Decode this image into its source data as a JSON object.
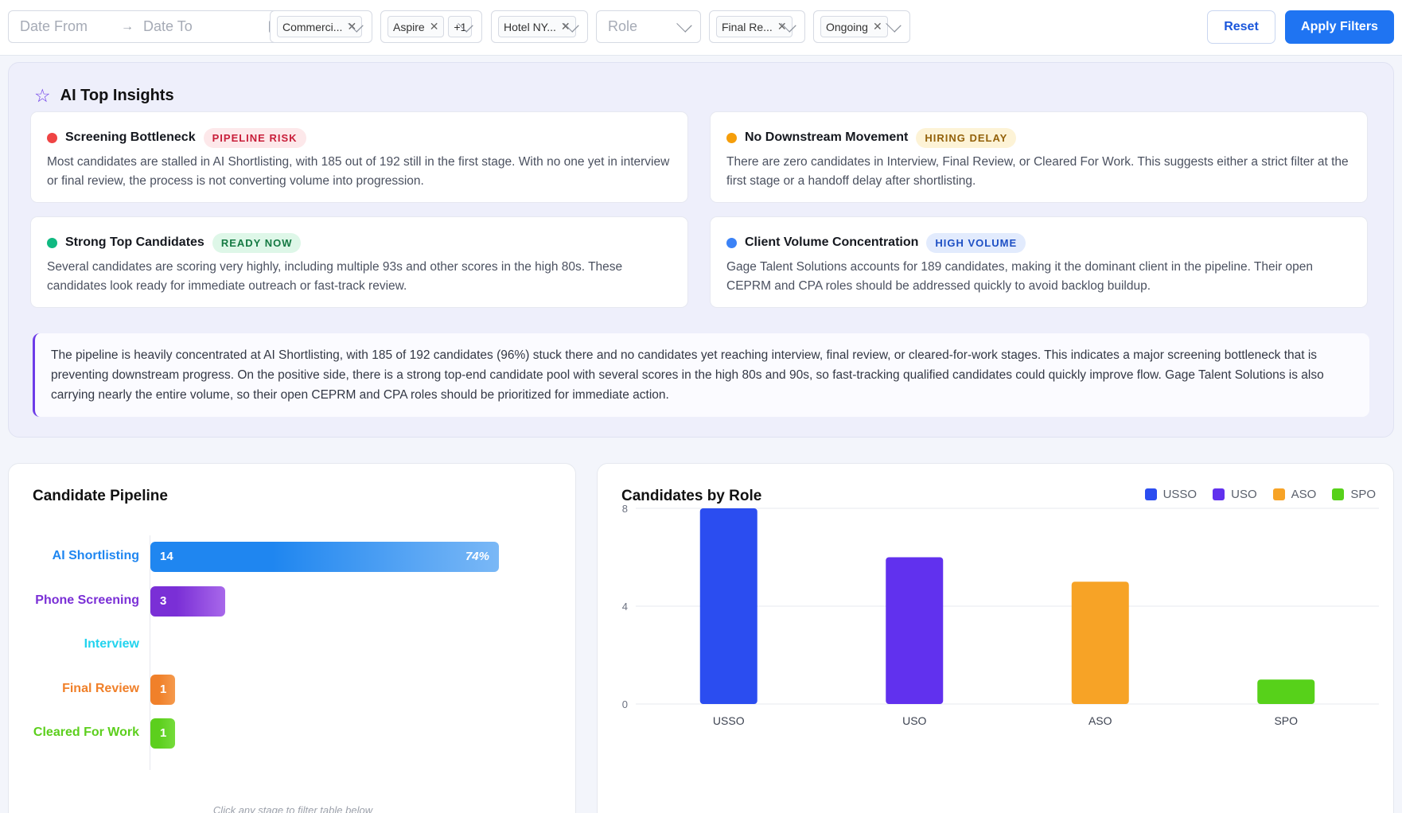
{
  "filters": {
    "date_from_placeholder": "Date From",
    "date_to_placeholder": "Date To",
    "client_tag": "Commerci...",
    "program_tag": "Aspire",
    "program_more": "+1",
    "location_tag": "Hotel NY...",
    "role_placeholder": "Role",
    "stage_tag": "Final Re...",
    "status_tag": "Ongoing",
    "reset_label": "Reset",
    "apply_label": "Apply Filters"
  },
  "insights": {
    "title": "AI Top Insights",
    "cards": [
      {
        "title": "Screening Bottleneck",
        "badge": "PIPELINE RISK",
        "dot_color": "#ef4444",
        "badge_bg": "#fde8ea",
        "badge_fg": "#c81e3a",
        "text": "Most candidates are stalled in AI Shortlisting, with 185 out of 192 still in the first stage. With no one yet in interview or final review, the process is not converting volume into progression."
      },
      {
        "title": "No Downstream Movement",
        "badge": "HIRING DELAY",
        "dot_color": "#f59e0b",
        "badge_bg": "#fdf3d6",
        "badge_fg": "#93610a",
        "text": "There are zero candidates in Interview, Final Review, or Cleared For Work. This suggests either a strict filter at the first stage or a handoff delay after shortlisting."
      },
      {
        "title": "Strong Top Candidates",
        "badge": "READY NOW",
        "dot_color": "#10b981",
        "badge_bg": "#def7e8",
        "badge_fg": "#157a43",
        "text": "Several candidates are scoring very highly, including multiple 93s and other scores in the high 80s. These candidates look ready for immediate outreach or fast-track review."
      },
      {
        "title": "Client Volume Concentration",
        "badge": "HIGH VOLUME",
        "dot_color": "#3b82f6",
        "badge_bg": "#e2ebfd",
        "badge_fg": "#1d4fc4",
        "text": "Gage Talent Solutions accounts for 189 candidates, making it the dominant client in the pipeline. Their open CEPRM and CPA roles should be addressed quickly to avoid backlog buildup."
      }
    ],
    "summary": "The pipeline is heavily concentrated at AI Shortlisting, with 185 of 192 candidates (96%) stuck there and no candidates yet reaching interview, final review, or cleared-for-work stages. This indicates a major screening bottleneck that is preventing downstream progress. On the positive side, there is a strong top-end candidate pool with several scores in the high 80s and 90s, so fast-tracking qualified candidates could quickly improve flow. Gage Talent Solutions is also carrying nearly the entire volume, so their open CEPRM and CPA roles should be prioritized for immediate action."
  },
  "pipeline": {
    "title": "Candidate Pipeline",
    "hint": "Click any stage to filter table below",
    "stages": [
      {
        "label": "AI Shortlisting",
        "count": 14,
        "pct": "74%",
        "color": "#1f86f0",
        "color2": "#7ab8f6"
      },
      {
        "label": "Phone Screening",
        "count": 3,
        "pct": "",
        "color": "#7a2fd6",
        "color2": "#a868ea"
      },
      {
        "label": "Interview",
        "count": 0,
        "pct": "",
        "color": "#22d3ee",
        "color2": "#22d3ee"
      },
      {
        "label": "Final Review",
        "count": 1,
        "pct": "",
        "color": "#f0802a",
        "color2": "#f59a4d"
      },
      {
        "label": "Cleared For Work",
        "count": 1,
        "pct": "",
        "color": "#5ccf1d",
        "color2": "#76dc3b"
      }
    ]
  },
  "chart_data": {
    "type": "bar",
    "title": "Candidates by Role",
    "categories": [
      "USSO",
      "USO",
      "ASO",
      "SPO"
    ],
    "values": [
      8,
      6,
      5,
      1
    ],
    "colors": [
      "#2b4df0",
      "#6131ee",
      "#f7a326",
      "#57d11a"
    ],
    "legend": [
      "USSO",
      "USO",
      "ASO",
      "SPO"
    ],
    "legend_position": "top-right",
    "yticks": [
      0,
      4,
      8
    ],
    "ylim": [
      0,
      8
    ],
    "grid": true,
    "xlabel": "",
    "ylabel": ""
  }
}
